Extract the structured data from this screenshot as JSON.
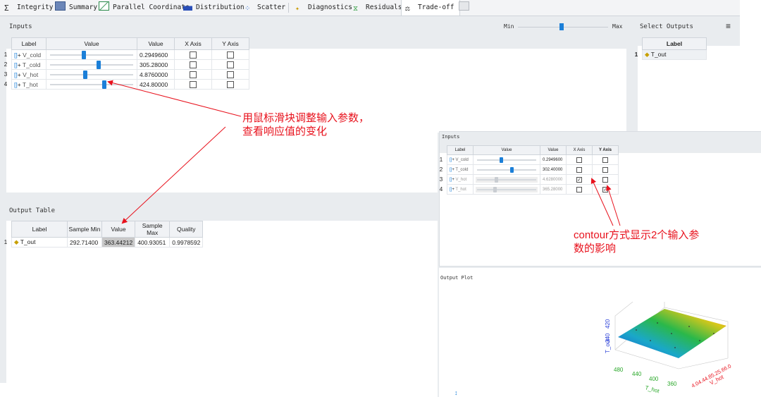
{
  "tabs": [
    {
      "label": "Integrity",
      "icon": "sigma-icon"
    },
    {
      "label": "Summary",
      "icon": "table-icon"
    },
    {
      "label": "Parallel Coordinate",
      "icon": "parallel-icon"
    },
    {
      "label": "Distribution",
      "icon": "histogram-icon"
    },
    {
      "label": "Scatter",
      "icon": "scatter-icon"
    },
    {
      "label": "Diagnostics",
      "icon": "diagnostics-icon"
    },
    {
      "label": "Residuals",
      "icon": "residuals-icon"
    },
    {
      "label": "Trade-off",
      "icon": "balance-icon"
    }
  ],
  "inputs_panel": {
    "title": "Inputs",
    "min_label": "Min",
    "max_label": "Max",
    "headers": [
      "Label",
      "Value",
      "Value",
      "X Axis",
      "Y Axis"
    ],
    "rows": [
      {
        "n": "1",
        "label": "V_cold",
        "value": "0.2949600",
        "slider": 0.38
      },
      {
        "n": "2",
        "label": "T_cold",
        "value": "305.28000",
        "slider": 0.62
      },
      {
        "n": "3",
        "label": "V_hot",
        "value": "4.8760000",
        "slider": 0.41
      },
      {
        "n": "4",
        "label": "T_hot",
        "value": "424.80000",
        "slider": 0.66
      }
    ]
  },
  "select_outputs": {
    "title": "Select Outputs",
    "header": "Label",
    "rows": [
      {
        "n": "1",
        "label": "T_out"
      }
    ]
  },
  "output_table": {
    "title": "Output Table",
    "headers": [
      "Label",
      "Sample Min",
      "Value",
      "Sample Max",
      "Quality"
    ],
    "rows": [
      {
        "n": "1",
        "label": "T_out",
        "sample_min": "292.71400",
        "value": "363.44212",
        "sample_max": "400.93051",
        "quality": "0.9978592"
      }
    ]
  },
  "annotation_1": {
    "line1": "用鼠标滑块调整输入参数，",
    "line2": "查看响应值的变化"
  },
  "inset_inputs": {
    "title": "Inputs",
    "headers": [
      "Label",
      "Value",
      "Value",
      "X Axis",
      "Y Axis"
    ],
    "rows": [
      {
        "n": "1",
        "label": "V_cold",
        "value": "0.2949600",
        "slider": 0.38,
        "x": false,
        "y": false,
        "dim": false
      },
      {
        "n": "2",
        "label": "T_cold",
        "value": "302.40000",
        "slider": 0.55,
        "x": false,
        "y": false,
        "dim": false
      },
      {
        "n": "3",
        "label": "V_hot",
        "value": "4.6280000",
        "slider": 0.3,
        "x": true,
        "y": false,
        "dim": true
      },
      {
        "n": "4",
        "label": "T_hot",
        "value": "365.28000",
        "slider": 0.28,
        "x": false,
        "y": true,
        "dim": true
      }
    ]
  },
  "annotation_2": {
    "line1": "contour方式显示2个输入参",
    "line2": "数的影响"
  },
  "output_plot": {
    "title": "Output Plot",
    "zlabel": "T_out",
    "zticks": [
      "340",
      "420"
    ],
    "xlabel": "T_hot",
    "xticks": [
      "480",
      "440",
      "400",
      "360"
    ],
    "ylabel": "V_hot",
    "yticks": "4.04.44.85.25.66.0"
  },
  "colors": {
    "accent": "#1b7fd8",
    "annotation": "#e8121d",
    "x_axis_label": "#2aa82a",
    "y_axis_label": "#e8121d",
    "z_axis_label": "#2a3fd8"
  }
}
